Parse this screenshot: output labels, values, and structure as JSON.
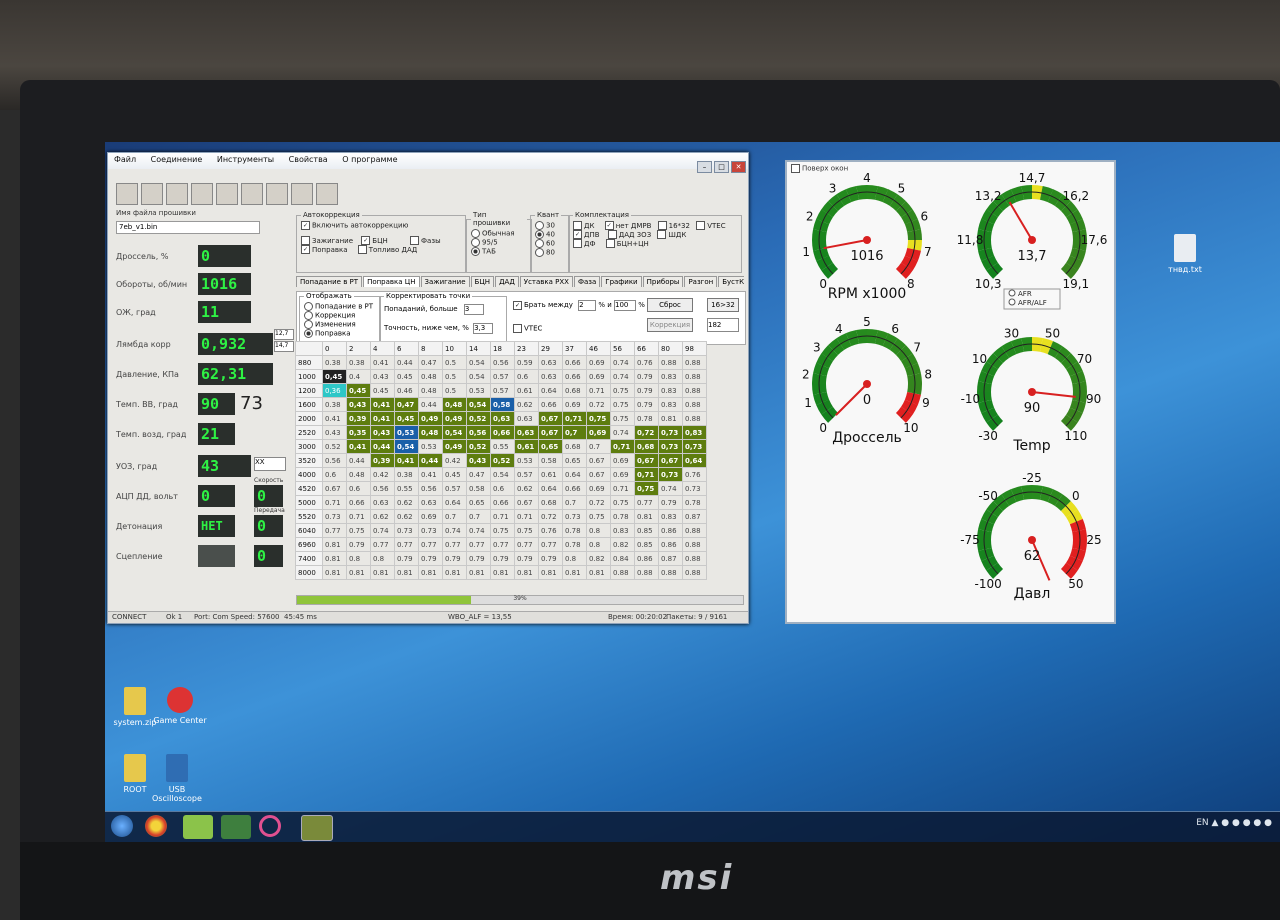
{
  "app": {
    "menu": [
      "Файл",
      "Соединение",
      "Инструменты",
      "Свойства",
      "О программе"
    ],
    "firmware_label": "Имя файла прошивки",
    "firmware_file": "7eb_v1.bin",
    "params": [
      {
        "label": "Дроссель, %",
        "value": "0"
      },
      {
        "label": "Обороты, об/мин",
        "value": "1016"
      },
      {
        "label": "ОЖ, град",
        "value": "11"
      },
      {
        "label": "Лямбда корр",
        "value": "0,932"
      },
      {
        "label": "Давление, КПа",
        "value": "62,31"
      },
      {
        "label": "Темп. ВВ, град",
        "value": "90",
        "extra": "73"
      },
      {
        "label": "Темп. возд, град",
        "value": "21"
      },
      {
        "label": "УОЗ, град",
        "value": "43",
        "extra": "XX"
      },
      {
        "label": "АЦП ДД, вольт",
        "value": "0",
        "extra_label": "Скорость",
        "extra": "0"
      },
      {
        "label": "Детонация",
        "value": "НЕТ",
        "extra_label": "Передача",
        "extra": "0"
      },
      {
        "label": "Сцепление",
        "value": "",
        "extra": "0"
      }
    ],
    "side_boxes": [
      "12,7",
      "14,7"
    ],
    "autocorr": {
      "title": "Автокоррекция",
      "enable": "Включить автокоррекцию",
      "items": [
        "Зажигание",
        "Поправка",
        "БЦН",
        "Топливо ДАД",
        "Фазы"
      ]
    },
    "fw_type": {
      "title": "Тип прошивки",
      "items": [
        "Обычная",
        "95/5",
        "ТАБ"
      ]
    },
    "quant": {
      "title": "Квант",
      "items": [
        "30",
        "40",
        "60",
        "80"
      ]
    },
    "config": {
      "title": "Комплектация",
      "items": [
        "ДК",
        "нет ДМРВ",
        "16*32",
        "VTEC",
        "ДПВ",
        "ДАД 3ОЗ",
        "ШДК",
        "ДФ",
        "БЦН+ЦН"
      ]
    },
    "tabs": [
      "Попадание в РТ",
      "Поправка ЦН",
      "Зажигание",
      "БЦН",
      "ДАД",
      "Уставка РХХ",
      "Фаза",
      "Графики",
      "Приборы",
      "Разгон",
      "БустКонтроль"
    ],
    "display": {
      "title": "Отображать",
      "items": [
        "Попадание в РТ",
        "Коррекция",
        "Изменения",
        "Поправка"
      ]
    },
    "correct": {
      "title": "Корректировать точки",
      "hits": "Попаданий, больше",
      "hits_val": "3",
      "accuracy": "Точность, ниже чем, %",
      "accuracy_val": "3,3"
    },
    "take_between": "Брать между",
    "between_a": "2",
    "between_mid": "% и",
    "between_b": "100",
    "between_unit": "%",
    "reset_btn": "Сброс",
    "size_btn": "16>32",
    "corr_btn": "Коррекция",
    "corr_val": "182",
    "vtec": "VTEC",
    "progress_text": "39%",
    "status": {
      "conn": "CONNECT",
      "ok": "Ok 1",
      "port": "Port: Com  Speed: 57600",
      "time": "45:45 ms",
      "wbo": "WBO_ALF = 13,55",
      "elapsed": "Время: 00:20:02",
      "packets": "Пакеты: 9 / 9161"
    }
  },
  "table": {
    "cols": [
      "0",
      "2",
      "4",
      "6",
      "8",
      "10",
      "14",
      "18",
      "23",
      "29",
      "37",
      "46",
      "56",
      "66",
      "80",
      "98"
    ],
    "rows": [
      {
        "rpm": "880",
        "cells": [
          "0.38",
          "0.38",
          "0.41",
          "0.44",
          "0.47",
          "0.5",
          "0.54",
          "0.56",
          "0.59",
          "0.63",
          "0.66",
          "0.69",
          "0.74",
          "0.76",
          "0.88",
          "0.88"
        ]
      },
      {
        "rpm": "1000",
        "cells": [
          "0,45",
          "0.4",
          "0.43",
          "0.45",
          "0.48",
          "0.5",
          "0.54",
          "0.57",
          "0.6",
          "0.63",
          "0.66",
          "0.69",
          "0.74",
          "0.79",
          "0.83",
          "0.88"
        ]
      },
      {
        "rpm": "1200",
        "cells": [
          "0,36",
          "0,45",
          "0.45",
          "0.46",
          "0.48",
          "0.5",
          "0.53",
          "0.57",
          "0.61",
          "0.64",
          "0.68",
          "0.71",
          "0.75",
          "0.79",
          "0.83",
          "0.88"
        ]
      },
      {
        "rpm": "1600",
        "cells": [
          "0.38",
          "0,43",
          "0,41",
          "0,47",
          "0.44",
          "0,48",
          "0,54",
          "0,58",
          "0.62",
          "0.66",
          "0.69",
          "0.72",
          "0.75",
          "0.79",
          "0.83",
          "0.88"
        ]
      },
      {
        "rpm": "2000",
        "cells": [
          "0.41",
          "0,39",
          "0,41",
          "0,45",
          "0,49",
          "0,49",
          "0,52",
          "0,63",
          "0.63",
          "0,67",
          "0,71",
          "0,75",
          "0.75",
          "0.78",
          "0.81",
          "0.88"
        ]
      },
      {
        "rpm": "2520",
        "cells": [
          "0.43",
          "0,35",
          "0,43",
          "0,53",
          "0,48",
          "0,54",
          "0,56",
          "0,66",
          "0,63",
          "0,67",
          "0,7",
          "0,69",
          "0.74",
          "0,72",
          "0,73",
          "0,83"
        ]
      },
      {
        "rpm": "3000",
        "cells": [
          "0.52",
          "0,41",
          "0,44",
          "0,54",
          "0.53",
          "0,49",
          "0,52",
          "0.55",
          "0,61",
          "0,65",
          "0.68",
          "0.7",
          "0,71",
          "0,68",
          "0,73",
          "0,73"
        ]
      },
      {
        "rpm": "3520",
        "cells": [
          "0.56",
          "0.44",
          "0,39",
          "0,41",
          "0,44",
          "0.42",
          "0,43",
          "0,52",
          "0.53",
          "0.58",
          "0.65",
          "0.67",
          "0.69",
          "0,67",
          "0,67",
          "0,64"
        ]
      },
      {
        "rpm": "4000",
        "cells": [
          "0.6",
          "0.48",
          "0.42",
          "0.38",
          "0.41",
          "0.45",
          "0.47",
          "0.54",
          "0.57",
          "0.61",
          "0.64",
          "0.67",
          "0.69",
          "0,71",
          "0,73",
          "0.76"
        ]
      },
      {
        "rpm": "4520",
        "cells": [
          "0.67",
          "0.6",
          "0.56",
          "0.55",
          "0.56",
          "0.57",
          "0.58",
          "0.6",
          "0.62",
          "0.64",
          "0.66",
          "0.69",
          "0.71",
          "0,75",
          "0.74",
          "0.73"
        ]
      },
      {
        "rpm": "5000",
        "cells": [
          "0.71",
          "0.66",
          "0.63",
          "0.62",
          "0.63",
          "0.64",
          "0.65",
          "0.66",
          "0.67",
          "0.68",
          "0.7",
          "0.72",
          "0.75",
          "0.77",
          "0.79",
          "0.78"
        ]
      },
      {
        "rpm": "5520",
        "cells": [
          "0.73",
          "0.71",
          "0.62",
          "0.62",
          "0.69",
          "0.7",
          "0.7",
          "0.71",
          "0.71",
          "0.72",
          "0.73",
          "0.75",
          "0.78",
          "0.81",
          "0.83",
          "0.87"
        ]
      },
      {
        "rpm": "6040",
        "cells": [
          "0.77",
          "0.75",
          "0.74",
          "0.73",
          "0.73",
          "0.74",
          "0.74",
          "0.75",
          "0.75",
          "0.76",
          "0.78",
          "0.8",
          "0.83",
          "0.85",
          "0.86",
          "0.88"
        ]
      },
      {
        "rpm": "6960",
        "cells": [
          "0.81",
          "0.79",
          "0.77",
          "0.77",
          "0.77",
          "0.77",
          "0.77",
          "0.77",
          "0.77",
          "0.77",
          "0.78",
          "0.8",
          "0.82",
          "0.85",
          "0.86",
          "0.88"
        ]
      },
      {
        "rpm": "7400",
        "cells": [
          "0.81",
          "0.8",
          "0.8",
          "0.79",
          "0.79",
          "0.79",
          "0.79",
          "0.79",
          "0.79",
          "0.79",
          "0.8",
          "0.82",
          "0.84",
          "0.86",
          "0.87",
          "0.88"
        ]
      },
      {
        "rpm": "8000",
        "cells": [
          "0.81",
          "0.81",
          "0.81",
          "0.81",
          "0.81",
          "0.81",
          "0.81",
          "0.81",
          "0.81",
          "0.81",
          "0.81",
          "0.81",
          "0.88",
          "0.88",
          "0.88",
          "0.88"
        ]
      }
    ]
  },
  "gauges": {
    "topmost": "Поверх окон",
    "list": [
      {
        "id": "rpm",
        "label": "RPM x1000",
        "value": "1016",
        "ticks": [
          "0",
          "1",
          "2",
          "3",
          "4",
          "5",
          "6",
          "7",
          "8"
        ],
        "reading": 1.016
      },
      {
        "id": "afr",
        "label": "",
        "value": "13,7",
        "ticks": [
          "10,3",
          "11,8",
          "13,2",
          "14,7",
          "16,2",
          "17,6",
          "19,1"
        ],
        "reading": 13.7,
        "options": [
          "AFR",
          "AFR/ALF"
        ]
      },
      {
        "id": "throttle",
        "label": "Дроссель",
        "value": "0",
        "ticks": [
          "0",
          "1",
          "2",
          "3",
          "4",
          "5",
          "6",
          "7",
          "8",
          "9",
          "10"
        ],
        "reading": 0
      },
      {
        "id": "temp",
        "label": "Temp",
        "value": "90",
        "ticks": [
          "-30",
          "-10",
          "10",
          "30",
          "50",
          "70",
          "90",
          "110"
        ],
        "reading": 90
      },
      {
        "id": "press",
        "label": "Давл",
        "value": "62",
        "ticks": [
          "-100",
          "-75",
          "-50",
          "-25",
          "0",
          "25",
          "50"
        ],
        "reading": 62
      }
    ]
  },
  "desktop": {
    "icons": [
      "system.zip",
      "Game Center",
      "ROOT",
      "USB Oscilloscope",
      "тнвд.txt"
    ],
    "tray": "EN"
  },
  "brand": "msi"
}
